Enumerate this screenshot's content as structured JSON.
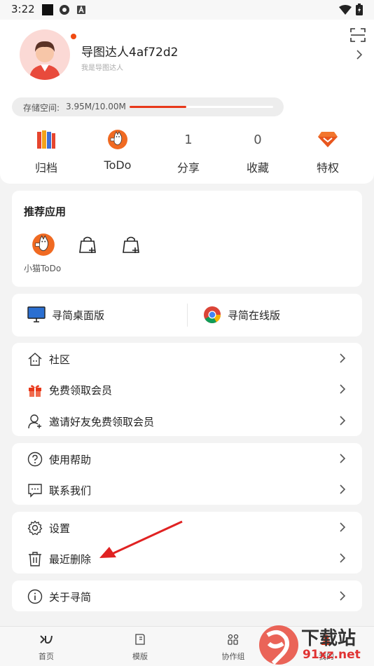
{
  "status": {
    "time": "3:22"
  },
  "profile": {
    "name": "导图达人4af72d2",
    "subtitle": "我是导图达人"
  },
  "storage": {
    "label": "存储空间:",
    "value": "3.95M/10.00M",
    "used_fraction": 0.395
  },
  "stats": [
    {
      "label": "归档",
      "icon": "archive-books-icon"
    },
    {
      "label": "ToDo",
      "icon": "cat-todo-icon"
    },
    {
      "label": "分享",
      "count": "1"
    },
    {
      "label": "收藏",
      "count": "0"
    },
    {
      "label": "特权",
      "icon": "diamond-icon"
    }
  ],
  "recommended": {
    "title": "推荐应用",
    "apps": [
      {
        "label": "小猫ToDo",
        "icon": "cat-todo-icon"
      },
      {
        "label": "",
        "icon": "shopping-bag-plus-icon"
      },
      {
        "label": "",
        "icon": "shopping-bag-plus-icon"
      }
    ]
  },
  "versions": {
    "desktop": "寻简桌面版",
    "online": "寻简在线版"
  },
  "menu1": [
    {
      "label": "社区",
      "icon": "community-house-icon"
    },
    {
      "label": "免费领取会员",
      "icon": "gift-icon"
    },
    {
      "label": "邀请好友免费领取会员",
      "icon": "person-add-icon"
    }
  ],
  "menu2": [
    {
      "label": "使用帮助",
      "icon": "help-circle-icon"
    },
    {
      "label": "联系我们",
      "icon": "chat-bubble-icon"
    }
  ],
  "menu3": [
    {
      "label": "设置",
      "icon": "gear-icon"
    },
    {
      "label": "最近删除",
      "icon": "trash-icon"
    }
  ],
  "menu4": [
    {
      "label": "关于寻简",
      "icon": "info-circle-icon"
    }
  ],
  "bottom_nav": [
    {
      "label": "首页",
      "icon": "home-logo-icon"
    },
    {
      "label": "模版",
      "icon": "template-book-icon"
    },
    {
      "label": "协作组",
      "icon": "team-icon"
    },
    {
      "label": "我的",
      "icon": "profile-icon"
    }
  ],
  "watermark": {
    "brand": "下载站",
    "url": "91xz.net"
  },
  "colors": {
    "accent": "#e8381a",
    "notify_dot": "#f04a12"
  }
}
